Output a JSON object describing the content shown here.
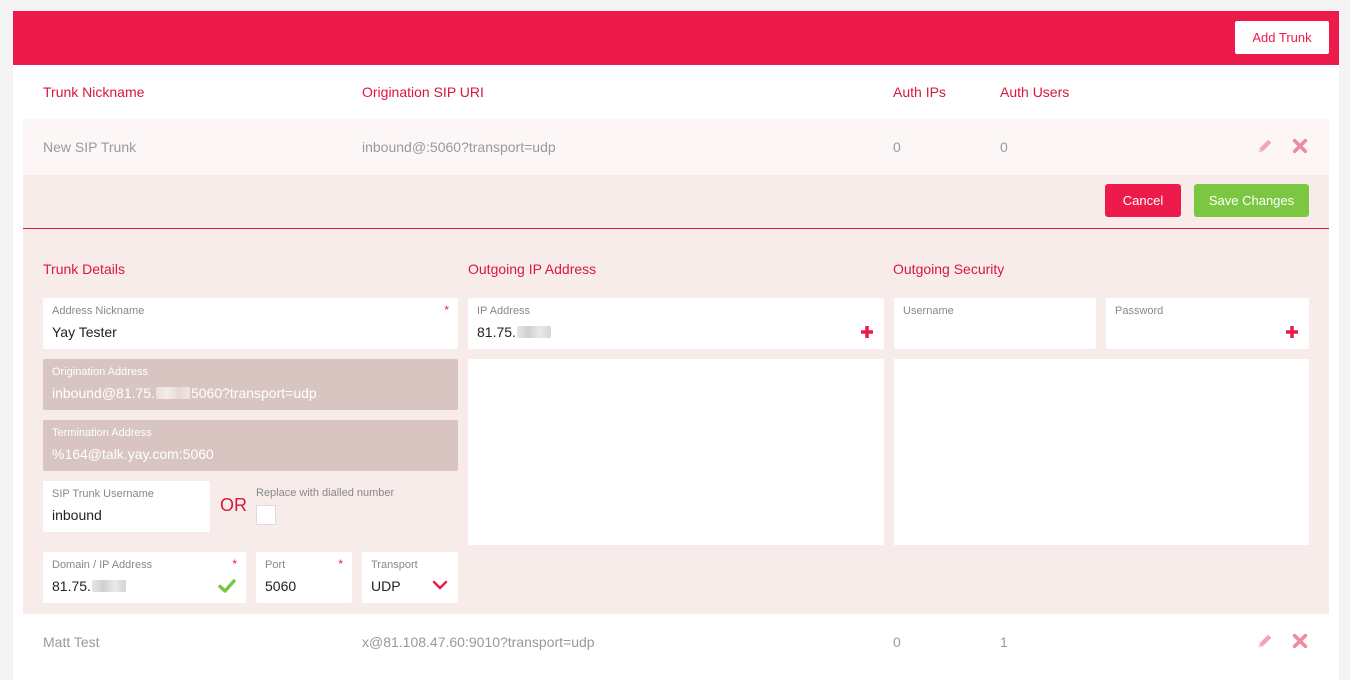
{
  "toolbar": {
    "add_trunk_label": "Add Trunk"
  },
  "columns": {
    "nickname": "Trunk Nickname",
    "origination": "Origination SIP URI",
    "auth_ips": "Auth IPs",
    "auth_users": "Auth Users"
  },
  "rows": [
    {
      "nickname": "New SIP Trunk",
      "origination": "inbound@:5060?transport=udp",
      "auth_ips": "0",
      "auth_users": "0"
    },
    {
      "nickname": "Matt Test",
      "origination": "x@81.108.47.60:9010?transport=udp",
      "auth_ips": "0",
      "auth_users": "1"
    }
  ],
  "editor": {
    "cancel_label": "Cancel",
    "save_label": "Save Changes",
    "sections": {
      "details": "Trunk Details",
      "outgoing_ip": "Outgoing IP Address",
      "outgoing_security": "Outgoing Security"
    },
    "address_nickname": {
      "label": "Address Nickname",
      "value": "Yay Tester",
      "required": "*"
    },
    "origination_address": {
      "label": "Origination Address",
      "value_prefix": "inbound@81.75.",
      "value_suffix": "5060?transport=udp"
    },
    "termination_address": {
      "label": "Termination Address",
      "value": "%164@talk.yay.com:5060"
    },
    "sip_username": {
      "label": "SIP Trunk Username",
      "value": "inbound"
    },
    "or_text": "OR",
    "replace_label": "Replace with dialled number",
    "domain": {
      "label": "Domain / IP Address",
      "value_prefix": "81.75.",
      "required": "*"
    },
    "port": {
      "label": "Port",
      "value": "5060",
      "required": "*"
    },
    "transport": {
      "label": "Transport",
      "value": "UDP"
    },
    "ip_address": {
      "label": "IP Address",
      "value_prefix": "81.75."
    },
    "username": {
      "label": "Username",
      "value": ""
    },
    "password": {
      "label": "Password",
      "value": ""
    }
  },
  "colors": {
    "brand": "#ec1b4b",
    "success": "#7cc741",
    "readonly_field": "#d8c5c1"
  }
}
